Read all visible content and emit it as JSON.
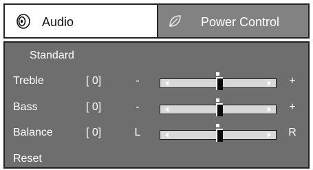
{
  "tabs": [
    {
      "label": "Audio",
      "icon": "speaker-icon",
      "active": true
    },
    {
      "label": "Power Control",
      "icon": "leaf-icon",
      "active": false
    }
  ],
  "audio": {
    "preset": "Standard",
    "settings": [
      {
        "name": "treble",
        "label": "Treble",
        "value_text": "[ 0]",
        "min_label": "-",
        "max_label": "+",
        "level": 0.5
      },
      {
        "name": "bass",
        "label": "Bass",
        "value_text": "[ 0]",
        "min_label": "-",
        "max_label": "+",
        "level": 0.5
      },
      {
        "name": "balance",
        "label": "Balance",
        "value_text": "[ 0]",
        "min_label": "L",
        "max_label": "R",
        "level": 0.5
      }
    ],
    "reset_label": "Reset"
  },
  "colors": {
    "panel_bg": "#6e6e6e",
    "inactive_tab_bg": "#828282",
    "track_bg": "#d8d8d8",
    "knob": "#0a0a0a"
  }
}
